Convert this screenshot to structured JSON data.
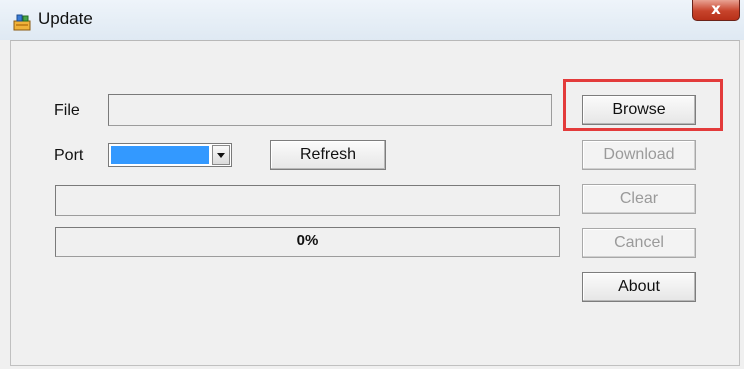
{
  "window": {
    "title": "Update",
    "close_label": "x"
  },
  "form": {
    "file_label": "File",
    "file_value": "",
    "port_label": "Port",
    "port_selected": "",
    "refresh_label": "Refresh",
    "status_value": "",
    "progress_text": "0%",
    "progress_fraction": 0
  },
  "actions": {
    "browse_label": "Browse",
    "download_label": "Download",
    "clear_label": "Clear",
    "cancel_label": "Cancel",
    "about_label": "About"
  },
  "colors": {
    "highlight": "#e33b3b",
    "combo_selection": "#3399ff"
  }
}
